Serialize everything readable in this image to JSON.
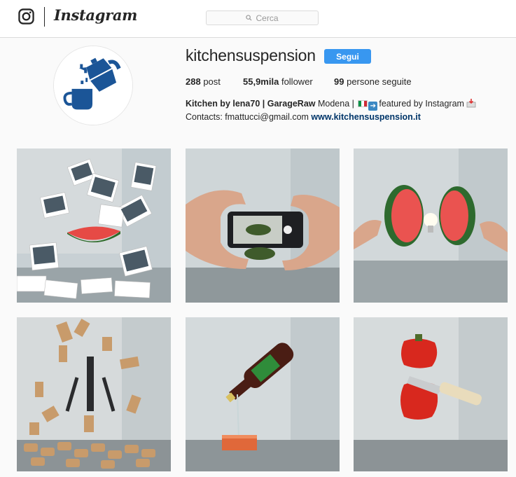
{
  "nav": {
    "logo_icon": "instagram-camera-icon",
    "wordmark": "Instagram",
    "search": {
      "placeholder": "Cerca",
      "icon": "search-icon"
    }
  },
  "profile": {
    "avatar_icon": "moka-pot-cup-icon",
    "username": "kitchensuspension",
    "follow_label": "Segui",
    "stats": {
      "posts_count": "288",
      "posts_label": "post",
      "followers_count": "55,9mila",
      "followers_label": "follower",
      "following_count": "99",
      "following_label": "persone seguite"
    },
    "bio": {
      "name": "Kitchen by lena70 | GarageRaw",
      "line1_rest": " Modena | ",
      "featured_text": "featured by Instagram",
      "contacts_text": "Contacts: fmattucci@gmail.com ",
      "website": "www.kitchensuspension.it"
    }
  },
  "posts": [
    {
      "subject": "floating polaroid photos and watermelon slice"
    },
    {
      "subject": "hands framing a smartphone photographing avocado"
    },
    {
      "subject": "split watermelon halves with light bulb"
    },
    {
      "subject": "floating wine corks and corkscrew"
    },
    {
      "subject": "floating cola bottle pouring onto brick"
    },
    {
      "subject": "red bell pepper sliced by knife"
    }
  ],
  "colors": {
    "accent": "#3897f0",
    "link": "#003569",
    "brand_blue": "#1b5597"
  }
}
